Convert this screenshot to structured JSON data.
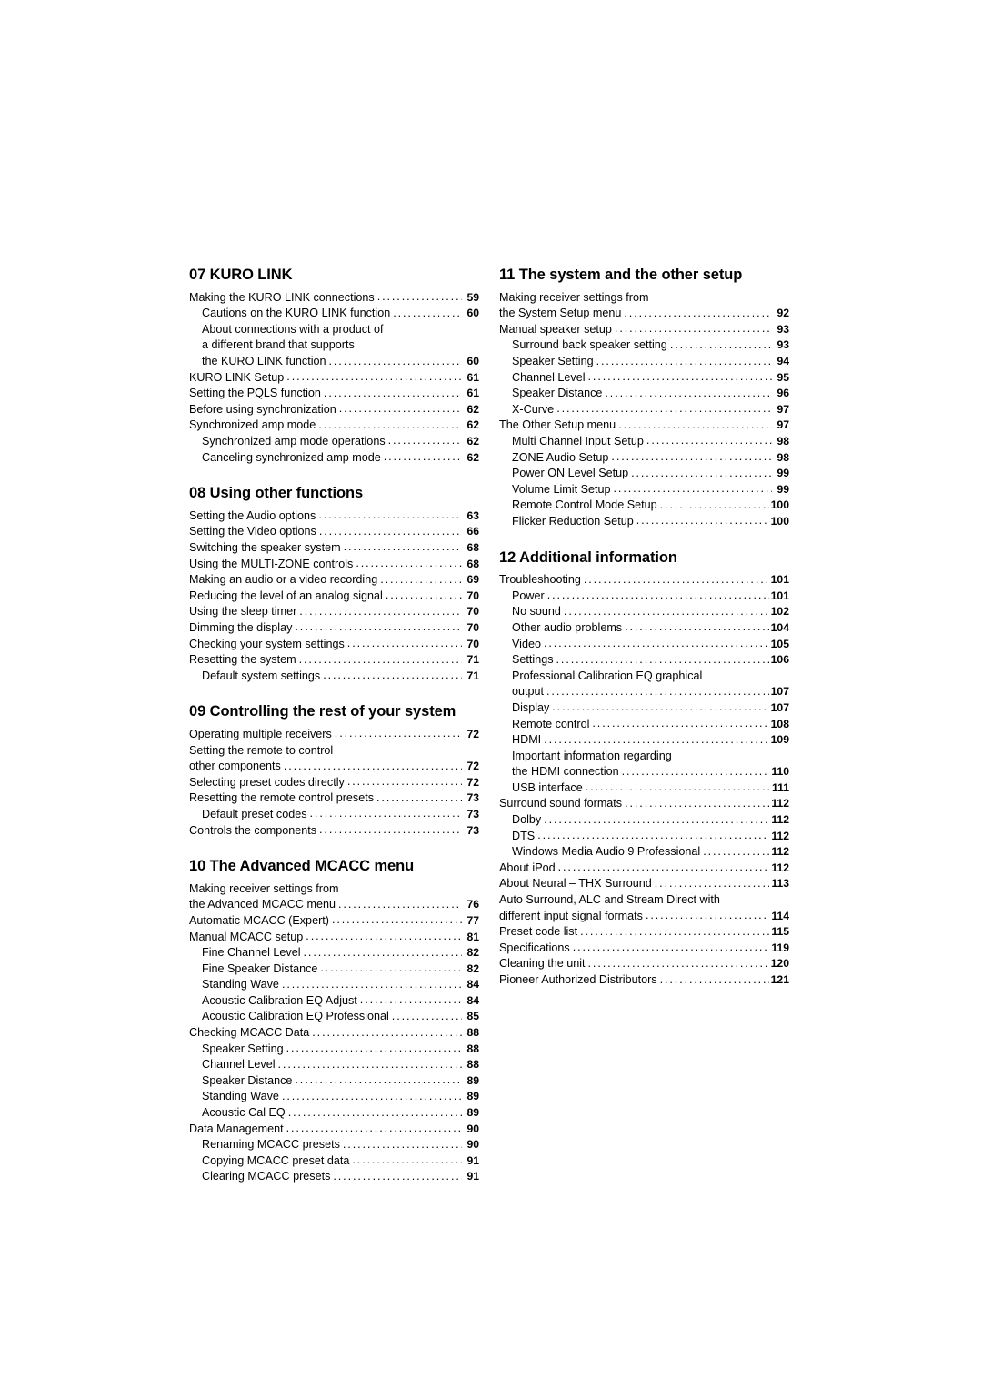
{
  "document": {
    "type": "table-of-contents"
  },
  "columns": [
    {
      "id": "left-column",
      "sections": [
        {
          "title": "07 KURO LINK",
          "entries": [
            {
              "label": "Making the KURO LINK connections",
              "page": "59",
              "indent": 0
            },
            {
              "label": "Cautions on the KURO LINK function",
              "page": "60",
              "indent": 1
            },
            {
              "label": "About connections with a product of",
              "page": "",
              "indent": 1,
              "nodots": true
            },
            {
              "label": "a different brand that supports",
              "page": "",
              "indent": 1,
              "nodots": true
            },
            {
              "label": "the KURO LINK function",
              "page": "60",
              "indent": 1
            },
            {
              "label": "KURO LINK Setup",
              "page": "61",
              "indent": 0
            },
            {
              "label": "Setting the PQLS function",
              "page": "61",
              "indent": 0
            },
            {
              "label": "Before using synchronization",
              "page": "62",
              "indent": 0
            },
            {
              "label": "Synchronized amp mode",
              "page": "62",
              "indent": 0
            },
            {
              "label": "Synchronized amp mode operations",
              "page": "62",
              "indent": 1
            },
            {
              "label": "Canceling synchronized amp mode",
              "page": "62",
              "indent": 1
            }
          ]
        },
        {
          "title": "08 Using other functions",
          "entries": [
            {
              "label": "Setting the Audio options",
              "page": "63",
              "indent": 0
            },
            {
              "label": "Setting the Video options",
              "page": "66",
              "indent": 0
            },
            {
              "label": "Switching the speaker system",
              "page": "68",
              "indent": 0
            },
            {
              "label": "Using the MULTI-ZONE controls",
              "page": "68",
              "indent": 0
            },
            {
              "label": "Making an audio or a video recording",
              "page": "69",
              "indent": 0
            },
            {
              "label": "Reducing the level of an analog signal",
              "page": "70",
              "indent": 0
            },
            {
              "label": "Using the sleep timer",
              "page": "70",
              "indent": 0
            },
            {
              "label": "Dimming the display",
              "page": "70",
              "indent": 0
            },
            {
              "label": "Checking your system settings",
              "page": "70",
              "indent": 0
            },
            {
              "label": "Resetting the system",
              "page": "71",
              "indent": 0
            },
            {
              "label": "Default system settings",
              "page": "71",
              "indent": 1
            }
          ]
        },
        {
          "title": "09 Controlling the rest of your system",
          "entries": [
            {
              "label": "Operating multiple receivers",
              "page": "72",
              "indent": 0
            },
            {
              "label": "Setting the remote to control",
              "page": "",
              "indent": 0,
              "nodots": true
            },
            {
              "label": "other components",
              "page": "72",
              "indent": 0
            },
            {
              "label": "Selecting preset codes directly",
              "page": "72",
              "indent": 0
            },
            {
              "label": "Resetting the remote control presets",
              "page": "73",
              "indent": 0
            },
            {
              "label": "Default preset codes",
              "page": "73",
              "indent": 1
            },
            {
              "label": "Controls the components",
              "page": "73",
              "indent": 0
            }
          ]
        },
        {
          "title": "10 The Advanced MCACC menu",
          "entries": [
            {
              "label": "Making receiver settings from",
              "page": "",
              "indent": 0,
              "nodots": true
            },
            {
              "label": "the Advanced MCACC menu",
              "page": "76",
              "indent": 0
            },
            {
              "label": "Automatic MCACC (Expert)",
              "page": "77",
              "indent": 0
            },
            {
              "label": "Manual MCACC setup",
              "page": "81",
              "indent": 0
            },
            {
              "label": "Fine Channel Level",
              "page": "82",
              "indent": 1
            },
            {
              "label": "Fine Speaker Distance",
              "page": "82",
              "indent": 1
            },
            {
              "label": "Standing Wave",
              "page": "84",
              "indent": 1
            },
            {
              "label": "Acoustic Calibration EQ Adjust",
              "page": "84",
              "indent": 1
            },
            {
              "label": "Acoustic Calibration EQ Professional",
              "page": "85",
              "indent": 1
            },
            {
              "label": "Checking MCACC Data",
              "page": "88",
              "indent": 0
            },
            {
              "label": "Speaker Setting",
              "page": "88",
              "indent": 1
            },
            {
              "label": "Channel Level",
              "page": "88",
              "indent": 1
            },
            {
              "label": "Speaker Distance",
              "page": "89",
              "indent": 1
            },
            {
              "label": "Standing Wave",
              "page": "89",
              "indent": 1
            },
            {
              "label": "Acoustic Cal EQ",
              "page": "89",
              "indent": 1
            },
            {
              "label": "Data Management",
              "page": "90",
              "indent": 0
            },
            {
              "label": "Renaming MCACC presets",
              "page": "90",
              "indent": 1
            },
            {
              "label": "Copying MCACC preset data",
              "page": "91",
              "indent": 1
            },
            {
              "label": "Clearing MCACC presets",
              "page": "91",
              "indent": 1
            }
          ]
        }
      ]
    },
    {
      "id": "right-column",
      "sections": [
        {
          "title": "11 The system and the other setup",
          "entries": [
            {
              "label": "Making receiver settings from",
              "page": "",
              "indent": 0,
              "nodots": true
            },
            {
              "label": "the System Setup menu",
              "page": "92",
              "indent": 0
            },
            {
              "label": "Manual speaker setup",
              "page": "93",
              "indent": 0
            },
            {
              "label": "Surround back speaker setting",
              "page": "93",
              "indent": 1
            },
            {
              "label": "Speaker Setting",
              "page": "94",
              "indent": 1
            },
            {
              "label": "Channel Level",
              "page": "95",
              "indent": 1
            },
            {
              "label": "Speaker Distance",
              "page": "96",
              "indent": 1
            },
            {
              "label": "X-Curve",
              "page": "97",
              "indent": 1
            },
            {
              "label": "The Other Setup menu",
              "page": "97",
              "indent": 0
            },
            {
              "label": "Multi Channel Input Setup",
              "page": "98",
              "indent": 1
            },
            {
              "label": "ZONE Audio Setup",
              "page": "98",
              "indent": 1
            },
            {
              "label": "Power ON Level Setup",
              "page": "99",
              "indent": 1
            },
            {
              "label": "Volume Limit Setup",
              "page": "99",
              "indent": 1
            },
            {
              "label": "Remote Control Mode Setup",
              "page": "100",
              "indent": 1
            },
            {
              "label": "Flicker Reduction Setup",
              "page": "100",
              "indent": 1
            }
          ]
        },
        {
          "title": "12 Additional information",
          "entries": [
            {
              "label": "Troubleshooting",
              "page": "101",
              "indent": 0
            },
            {
              "label": "Power",
              "page": "101",
              "indent": 1
            },
            {
              "label": "No sound",
              "page": "102",
              "indent": 1
            },
            {
              "label": "Other audio problems",
              "page": "104",
              "indent": 1
            },
            {
              "label": "Video",
              "page": "105",
              "indent": 1
            },
            {
              "label": "Settings",
              "page": "106",
              "indent": 1
            },
            {
              "label": "Professional Calibration EQ graphical",
              "page": "",
              "indent": 1,
              "nodots": true
            },
            {
              "label": "output",
              "page": "107",
              "indent": 1
            },
            {
              "label": "Display",
              "page": "107",
              "indent": 1
            },
            {
              "label": "Remote control",
              "page": "108",
              "indent": 1
            },
            {
              "label": "HDMI",
              "page": "109",
              "indent": 1
            },
            {
              "label": "Important information regarding",
              "page": "",
              "indent": 1,
              "nodots": true
            },
            {
              "label": "the HDMI connection",
              "page": "110",
              "indent": 1
            },
            {
              "label": "USB interface",
              "page": "111",
              "indent": 1
            },
            {
              "label": "Surround sound formats",
              "page": "112",
              "indent": 0
            },
            {
              "label": "Dolby",
              "page": "112",
              "indent": 1
            },
            {
              "label": "DTS",
              "page": "112",
              "indent": 1
            },
            {
              "label": "Windows Media Audio 9 Professional",
              "page": "112",
              "indent": 1
            },
            {
              "label": "About iPod",
              "page": "112",
              "indent": 0
            },
            {
              "label": "About Neural – THX Surround",
              "page": "113",
              "indent": 0
            },
            {
              "label": "Auto Surround, ALC and Stream Direct with",
              "page": "",
              "indent": 0,
              "nodots": true
            },
            {
              "label": "different input signal formats",
              "page": "114",
              "indent": 0
            },
            {
              "label": "Preset code list",
              "page": "115",
              "indent": 0
            },
            {
              "label": "Specifications",
              "page": "119",
              "indent": 0
            },
            {
              "label": "Cleaning the unit",
              "page": "120",
              "indent": 0
            },
            {
              "label": "Pioneer Authorized Distributors",
              "page": "121",
              "indent": 0
            }
          ]
        }
      ]
    }
  ]
}
